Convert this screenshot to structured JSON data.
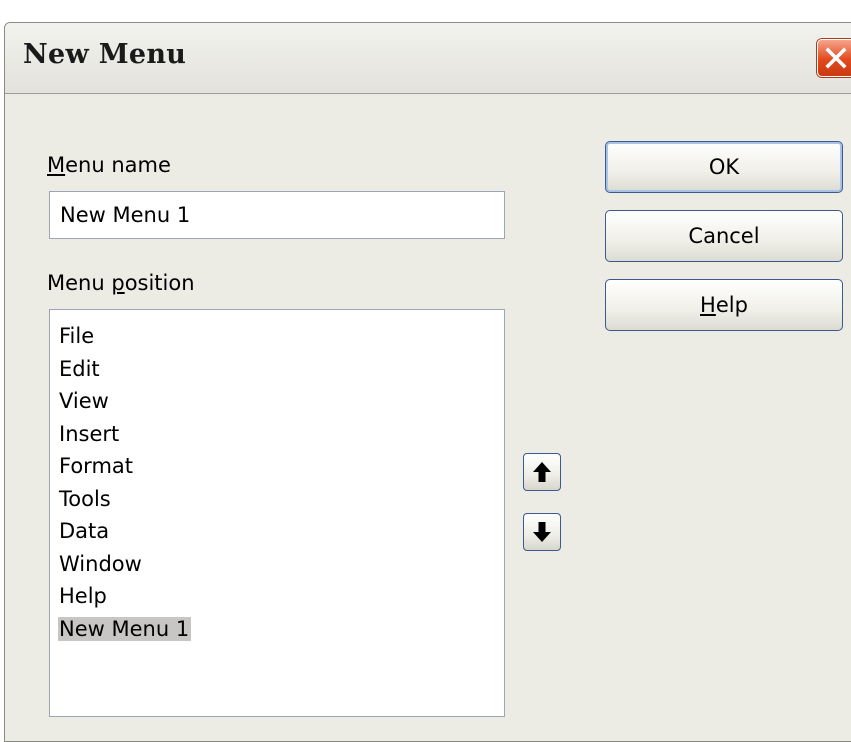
{
  "dialog": {
    "title": "New Menu"
  },
  "menu_name": {
    "label_mnemonic": "M",
    "label_rest": "enu name",
    "value": "New Menu 1"
  },
  "menu_position": {
    "label_before": "Menu ",
    "label_mnemonic": "p",
    "label_after": "osition",
    "items": [
      "File",
      "Edit",
      "View",
      "Insert",
      "Format",
      "Tools",
      "Data",
      "Window",
      "Help",
      "New Menu 1"
    ],
    "selected_index": 9
  },
  "buttons": {
    "ok": "OK",
    "cancel": "Cancel",
    "help_mnemonic": "H",
    "help_rest": "elp"
  },
  "icons": {
    "close": "close-icon",
    "up": "arrow-up-icon",
    "down": "arrow-down-icon"
  },
  "colors": {
    "dialog_bg": "#ecebe4",
    "close_button": "#e2491d",
    "selection_bg": "#c7c6c4",
    "button_border": "#3c5a8f"
  }
}
